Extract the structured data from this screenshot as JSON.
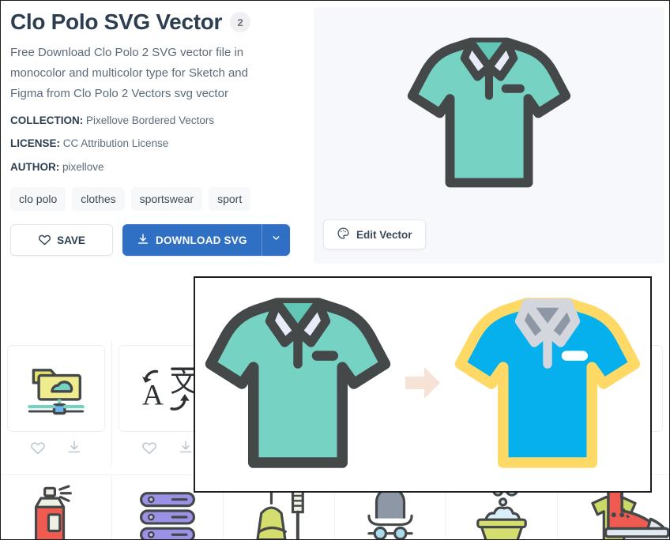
{
  "header": {
    "title": "Clo Polo SVG Vector",
    "count_badge": "2",
    "description": "Free Download Clo Polo 2 SVG vector file in monocolor and multicolor type for Sketch and Figma from Clo Polo 2 Vectors svg vector"
  },
  "meta": [
    {
      "key": "COLLECTION:",
      "value": " Pixellove Bordered Vectors"
    },
    {
      "key": "LICENSE:",
      "value": " CC Attribution License"
    },
    {
      "key": "AUTHOR:",
      "value": " pixellove"
    }
  ],
  "tags": [
    "clo polo",
    "clothes",
    "sportswear",
    "sport"
  ],
  "actions": {
    "save_label": "SAVE",
    "download_label": "DOWNLOAD SVG",
    "edit_vector_label": "Edit Vector"
  },
  "colors": {
    "primary_blue": "#2f6fc4",
    "title_text": "#2d3e50",
    "body_text": "#5c6b7a",
    "preview_bg": "#f6f8fc",
    "tag_bg": "#f7f8fa",
    "shirt_teal": "#76d3c3",
    "shirt_outline": "#444849",
    "shirt_collar": "#e8ecf8",
    "shirt_blue": "#05b0ed",
    "shirt_yellow": "#ffd966",
    "shirt_gray": "#d3d7dd",
    "arrow_peach": "#f7e3d6"
  },
  "preview": {
    "variant_label_mono": "monocolor polo shirt",
    "variant_label_multi": "multicolor polo shirt"
  },
  "related_icons": [
    {
      "name": "cloud-folder-network-icon"
    },
    {
      "name": "language-translate-icon"
    },
    {
      "name": "blank-icon-3"
    },
    {
      "name": "blank-icon-4"
    },
    {
      "name": "blank-icon-5"
    },
    {
      "name": "blank-icon-6"
    }
  ],
  "related_icons_row2": [
    {
      "name": "spray-bottle-icon"
    },
    {
      "name": "folded-towels-icon"
    },
    {
      "name": "broom-and-brush-icon"
    },
    {
      "name": "hat-and-glasses-icon"
    },
    {
      "name": "wash-basin-bubbles-icon"
    },
    {
      "name": "tshirt-hanger-icon"
    }
  ],
  "tool_labels": {
    "favorite": "favorite",
    "download": "download"
  }
}
